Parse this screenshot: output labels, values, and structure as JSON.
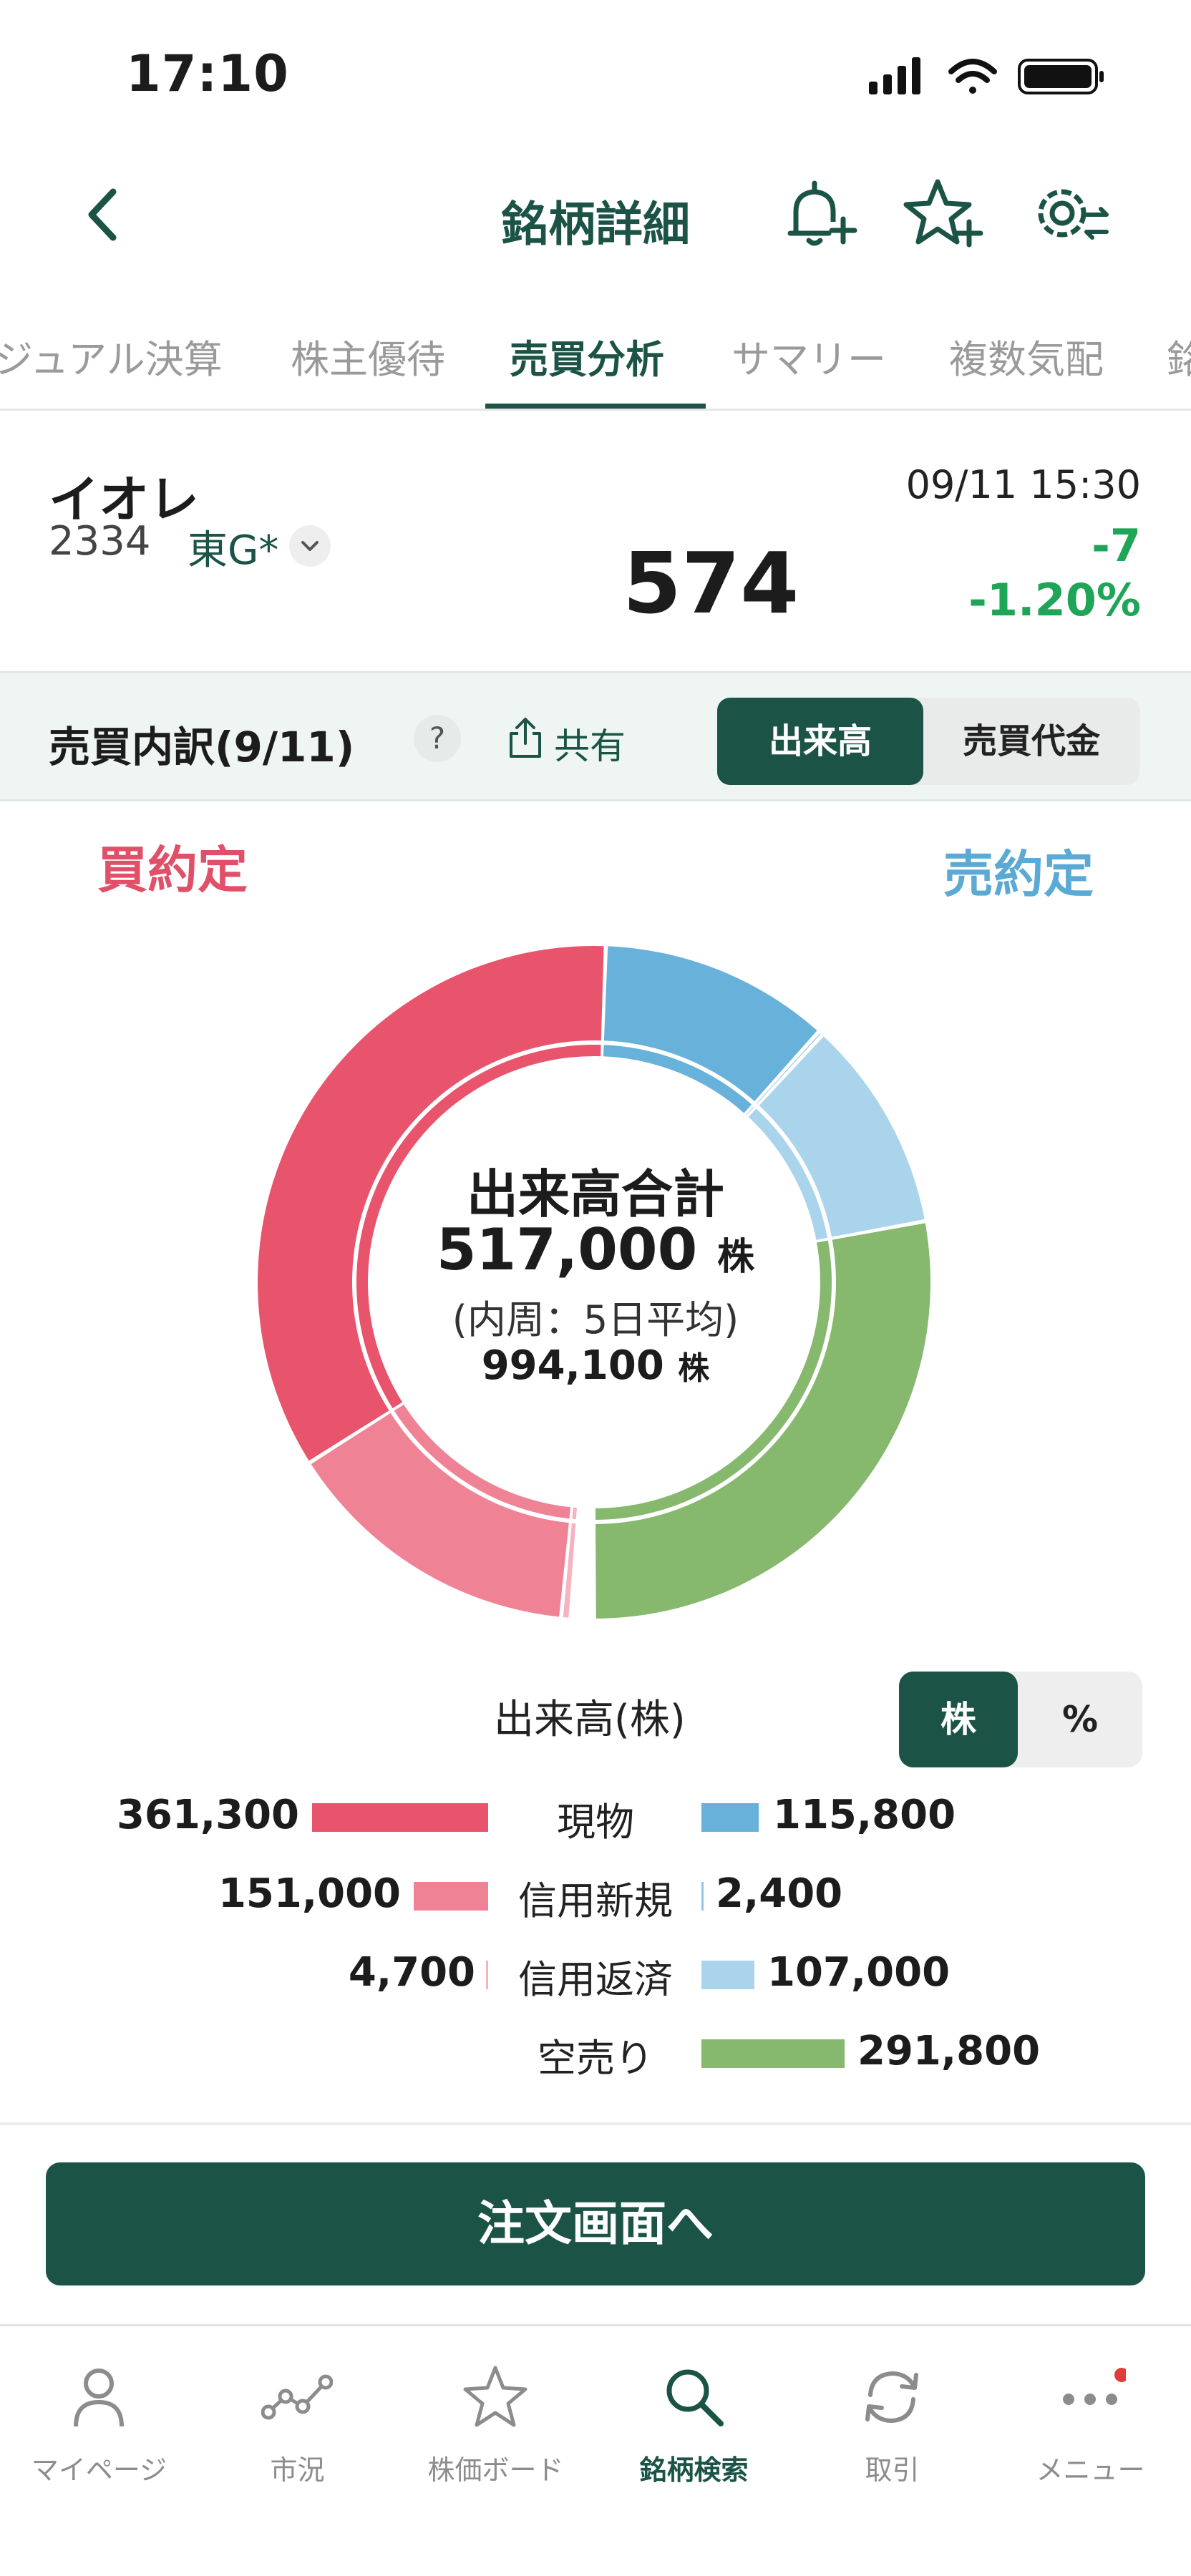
{
  "status": {
    "time": "17:10"
  },
  "nav": {
    "title": "銘柄詳細"
  },
  "tabs": [
    {
      "label": "ジュアル決算"
    },
    {
      "label": "株主優待"
    },
    {
      "label": "売買分析"
    },
    {
      "label": "サマリー"
    },
    {
      "label": "複数気配"
    },
    {
      "label": "銘"
    }
  ],
  "quote": {
    "name": "イオレ",
    "code": "2334",
    "market": "東G*",
    "price": "574",
    "time": "09/11 15:30",
    "change": "-7",
    "change_pct": "-1.20%"
  },
  "breakdown": {
    "title": "売買内訳(9/11)",
    "help": "?",
    "share": "共有",
    "mode_volume": "出来高",
    "mode_value": "売買代金"
  },
  "sides": {
    "buy": "買約定",
    "sell": "売約定"
  },
  "center": {
    "title": "出来高合計",
    "total": "517,000",
    "unit": "株",
    "note": "(内周：5日平均)",
    "avg": "994,100",
    "avg_unit": "株"
  },
  "legend": {
    "header": "出来高(株)",
    "unit_shares": "株",
    "unit_percent": "%",
    "rows": [
      {
        "label": "現物",
        "buy": "361,300",
        "sell": "115,800"
      },
      {
        "label": "信用新規",
        "buy": "151,000",
        "sell": "2,400"
      },
      {
        "label": "信用返済",
        "buy": "4,700",
        "sell": "107,000"
      },
      {
        "label": "空売り",
        "buy": "",
        "sell": "291,800"
      }
    ]
  },
  "chart_data": {
    "type": "pie",
    "title": "出来高合計",
    "outer_ring": {
      "buy": [
        {
          "name": "現物",
          "value": 361300,
          "color": "#e8546b"
        },
        {
          "name": "信用新規",
          "value": 151000,
          "color": "#ef8395"
        },
        {
          "name": "信用返済",
          "value": 4700,
          "color": "#f4b3bf"
        }
      ],
      "sell": [
        {
          "name": "現物",
          "value": 115800,
          "color": "#67b1da"
        },
        {
          "name": "信用新規",
          "value": 2400,
          "color": "#8ec6e6"
        },
        {
          "name": "信用返済",
          "value": 107000,
          "color": "#a9d4ec"
        },
        {
          "name": "空売り",
          "value": 291800,
          "color": "#86b86d"
        }
      ]
    },
    "inner_ring_label": "(内周：5日平均)",
    "inner_ring_total": 994100
  },
  "order": {
    "label": "注文画面へ"
  },
  "tabbar": [
    {
      "label": "マイページ",
      "icon": "person-icon"
    },
    {
      "label": "市況",
      "icon": "market-line-icon"
    },
    {
      "label": "株価ボード",
      "icon": "star-icon"
    },
    {
      "label": "銘柄検索",
      "icon": "search-icon"
    },
    {
      "label": "取引",
      "icon": "refresh-icon"
    },
    {
      "label": "メニュー",
      "icon": "more-icon"
    }
  ]
}
